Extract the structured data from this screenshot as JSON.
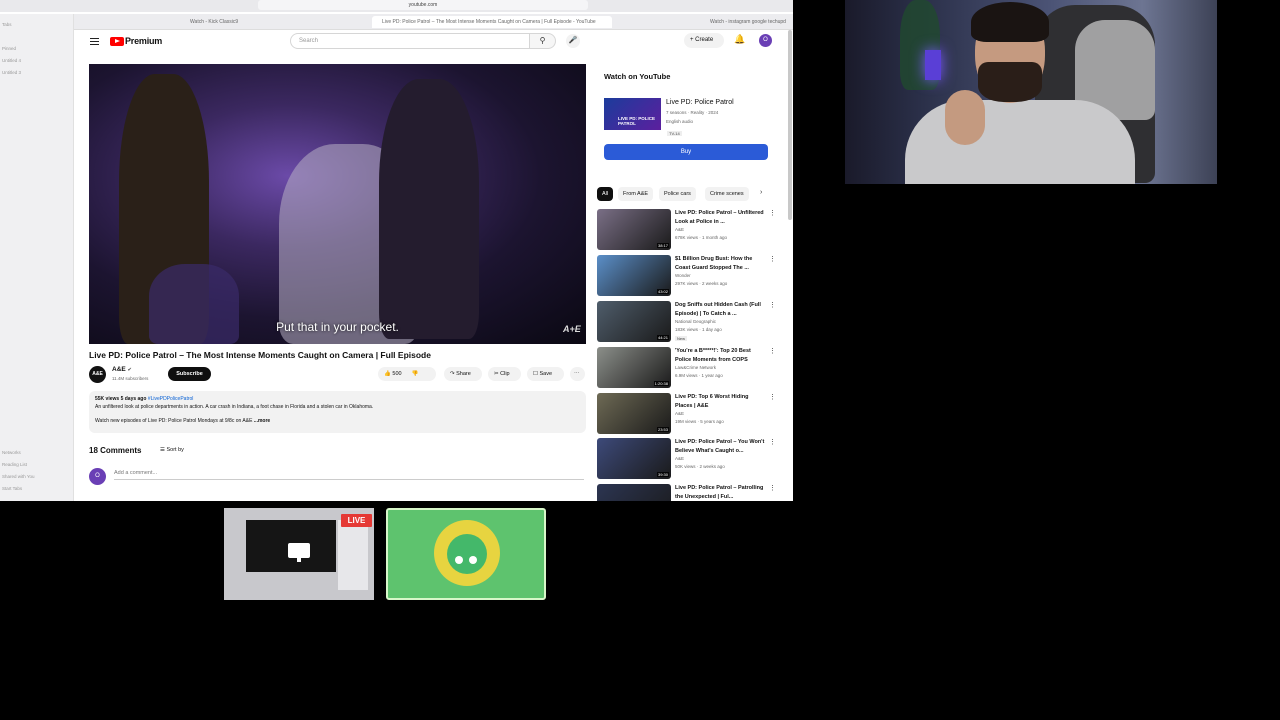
{
  "browser": {
    "url": "youtube.com",
    "tabs": [
      "Watch - Kick Classic9 ",
      "Live PD: Police Patrol – The Most Intense Moments Caught on Camera | Full Episode - YouTube",
      "Watch - instagram google techupd"
    ],
    "sidebar": [
      "Tabs",
      "Pinned",
      "Untitled 4",
      "Untitled 3",
      "Networks",
      "Reading List",
      "Shared with You",
      "Start Tabs"
    ]
  },
  "youtube": {
    "brand": "Premium",
    "search_placeholder": "Search",
    "create_label": "Create",
    "user_initial": "O",
    "icons": {
      "menu": "hamburger-icon",
      "search": "search-icon",
      "mic": "mic-icon",
      "bell": "bell-icon"
    }
  },
  "video": {
    "subtitle": "Put that in your pocket.",
    "watermark": "A+E",
    "title": "Live PD: Police Patrol – The Most Intense Moments Caught on Camera | Full Episode",
    "channel": "A&E",
    "channel_avatar": "A&E",
    "subscribers": "11.4M subscribers",
    "subscribe_label": "Subscribe",
    "likes": "500",
    "share_label": "Share",
    "clip_label": "Clip",
    "save_label": "Save",
    "description": {
      "meta": "55K views  5 days ago",
      "tag": "#LivePDPolicePatrol",
      "line1": "An unfiltered look at police departments in action. A car crash in Indiana, a foot chase in Florida and a stolen car in Oklahoma.",
      "line2": "Watch new episodes of Live PD: Police Patrol Mondays at 9/8c on A&E",
      "more": "...more"
    },
    "comments_count": "18 Comments",
    "sort_label": "Sort by",
    "add_comment_placeholder": "Add a comment..."
  },
  "watch_on_youtube": {
    "heading": "Watch on YouTube",
    "thumb_text": "LIVE PD: POLICE PATROL",
    "name": "Live PD: Police Patrol",
    "meta1": "7 seasons · Reality · 2024",
    "meta2": "English audio",
    "rating": "TV-14",
    "buy_label": "Buy"
  },
  "chips": [
    "All",
    "From A&E",
    "Police cars",
    "Crime scenes"
  ],
  "recommendations": [
    {
      "title": "Live PD: Police Patrol – Unfiltered Look at Police in ...",
      "channel": "A&E",
      "views": "678K views · 1 month ago",
      "duration": "38:17",
      "color": "#7a6f86"
    },
    {
      "title": "$1 Billion Drug Bust: How the Coast Guard Stopped The ...",
      "channel": "Wonder",
      "views": "297K views · 2 weeks ago",
      "duration": "43:02",
      "color": "#5b8fc9"
    },
    {
      "title": "Dog Sniffs out Hidden Cash (Full Episode) | To Catch a ...",
      "channel": "National Geographic",
      "views": "183K views · 1 day ago",
      "duration": "44:21",
      "color": "#4f5d6b",
      "badge": "New"
    },
    {
      "title": "'You're a B*****!': Top 20 Best Police Moments from COPS",
      "channel": "Law&Crime Network",
      "views": "6.9M views · 1 year ago",
      "duration": "1:20:38",
      "color": "#8c8f8a"
    },
    {
      "title": "Live PD: Top 6 Worst Hiding Places | A&E",
      "channel": "A&E",
      "views": "19M views · 5 years ago",
      "duration": "23:53",
      "color": "#6e6a55"
    },
    {
      "title": "Live PD: Police Patrol – You Won't Believe What's Caught o...",
      "channel": "A&E",
      "views": "50K views · 2 weeks ago",
      "duration": "39:30",
      "color": "#3d4a7a"
    },
    {
      "title": "Live PD: Police Patrol – Patrolling the Unexpected | Ful...",
      "channel": "",
      "views": "",
      "duration": "",
      "color": "#2c3552"
    }
  ],
  "stream": {
    "live_badge": "LIVE",
    "icons": [
      "monitor-icon",
      "bot-mascot-icon"
    ]
  }
}
